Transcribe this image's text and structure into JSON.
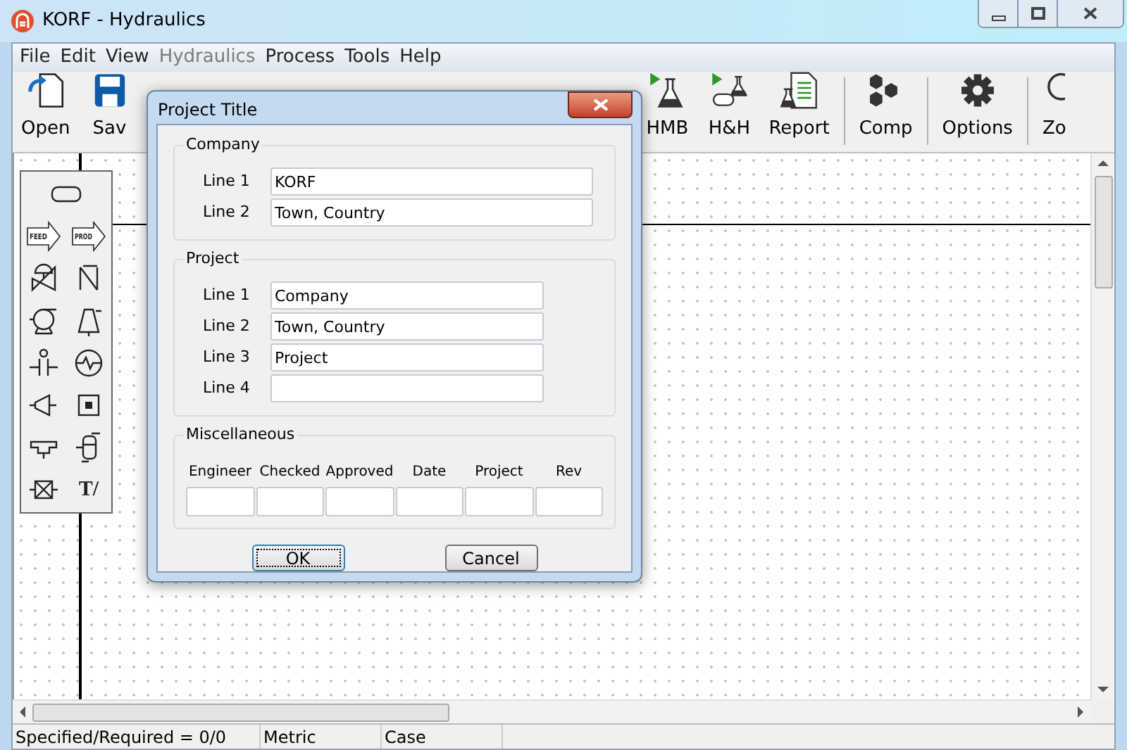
{
  "window": {
    "title": "KORF - Hydraulics"
  },
  "menu": [
    {
      "label": "File",
      "disabled": false
    },
    {
      "label": "Edit",
      "disabled": false
    },
    {
      "label": "View",
      "disabled": false
    },
    {
      "label": "Hydraulics",
      "disabled": true
    },
    {
      "label": "Process",
      "disabled": false
    },
    {
      "label": "Tools",
      "disabled": false
    },
    {
      "label": "Help",
      "disabled": false
    }
  ],
  "toolbar": [
    {
      "label": "Open",
      "kind": "open"
    },
    {
      "label": "Sav",
      "kind": "save"
    },
    {
      "label": "HMB",
      "kind": "hmb"
    },
    {
      "label": "H&H",
      "kind": "hh"
    },
    {
      "label": "Report",
      "kind": "report"
    },
    {
      "label": "Comp",
      "kind": "comp"
    },
    {
      "label": "Options",
      "kind": "options"
    },
    {
      "label": "Zo",
      "kind": "zoom"
    }
  ],
  "palette": [
    {
      "kind": "pipe"
    },
    {
      "kind": "feed",
      "label": "FEED"
    },
    {
      "kind": "prod",
      "label": "PROD"
    },
    {
      "kind": "valve"
    },
    {
      "kind": "check"
    },
    {
      "kind": "pump"
    },
    {
      "kind": "compressor"
    },
    {
      "kind": "orifice"
    },
    {
      "kind": "exchanger"
    },
    {
      "kind": "expander"
    },
    {
      "kind": "misc"
    },
    {
      "kind": "junction"
    },
    {
      "kind": "vessel"
    },
    {
      "kind": "box"
    },
    {
      "kind": "text",
      "label": "T/"
    }
  ],
  "dialog": {
    "title": "Project Title",
    "company": {
      "title": "Company",
      "lines": [
        {
          "label": "Line 1",
          "value": "KORF"
        },
        {
          "label": "Line 2",
          "value": "Town, Country"
        }
      ]
    },
    "project": {
      "title": "Project",
      "lines": [
        {
          "label": "Line 1",
          "value": "Company"
        },
        {
          "label": "Line 2",
          "value": "Town, Country"
        },
        {
          "label": "Line 3",
          "value": "Project"
        },
        {
          "label": "Line 4"
        }
      ]
    },
    "misc": {
      "title": "Miscellaneous",
      "columns": [
        "Engineer",
        "Checked",
        "Approved",
        "Date",
        "Project",
        "Rev"
      ]
    },
    "buttons": [
      {
        "label": "OK",
        "default": true
      },
      {
        "label": "Cancel",
        "default": false
      }
    ]
  },
  "status_bar": [
    "Specified/Required = 0/0",
    "Metric",
    "Case"
  ]
}
